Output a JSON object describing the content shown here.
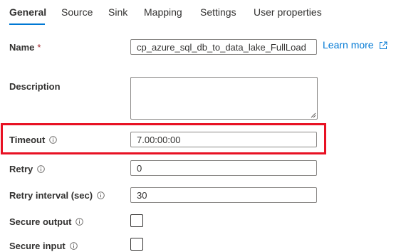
{
  "tabs": [
    {
      "label": "General",
      "active": true
    },
    {
      "label": "Source",
      "active": false
    },
    {
      "label": "Sink",
      "active": false
    },
    {
      "label": "Mapping",
      "active": false
    },
    {
      "label": "Settings",
      "active": false
    },
    {
      "label": "User properties",
      "active": false
    }
  ],
  "fields": {
    "name": {
      "label": "Name",
      "required_mark": "*",
      "value": "cp_azure_sql_db_to_data_lake_FullLoad"
    },
    "description": {
      "label": "Description",
      "value": ""
    },
    "timeout": {
      "label": "Timeout",
      "value": "7.00:00:00"
    },
    "retry": {
      "label": "Retry",
      "value": "0"
    },
    "retry_interval": {
      "label": "Retry interval (sec)",
      "value": "30"
    },
    "secure_output": {
      "label": "Secure output",
      "checked": false
    },
    "secure_input": {
      "label": "Secure input",
      "checked": false
    }
  },
  "learn_more": {
    "label": "Learn more"
  },
  "icons": {
    "info": "info-circle-icon",
    "external_link": "external-link-icon"
  },
  "colors": {
    "accent": "#0078d4",
    "highlight": "#e81123",
    "required": "#a4262c"
  }
}
